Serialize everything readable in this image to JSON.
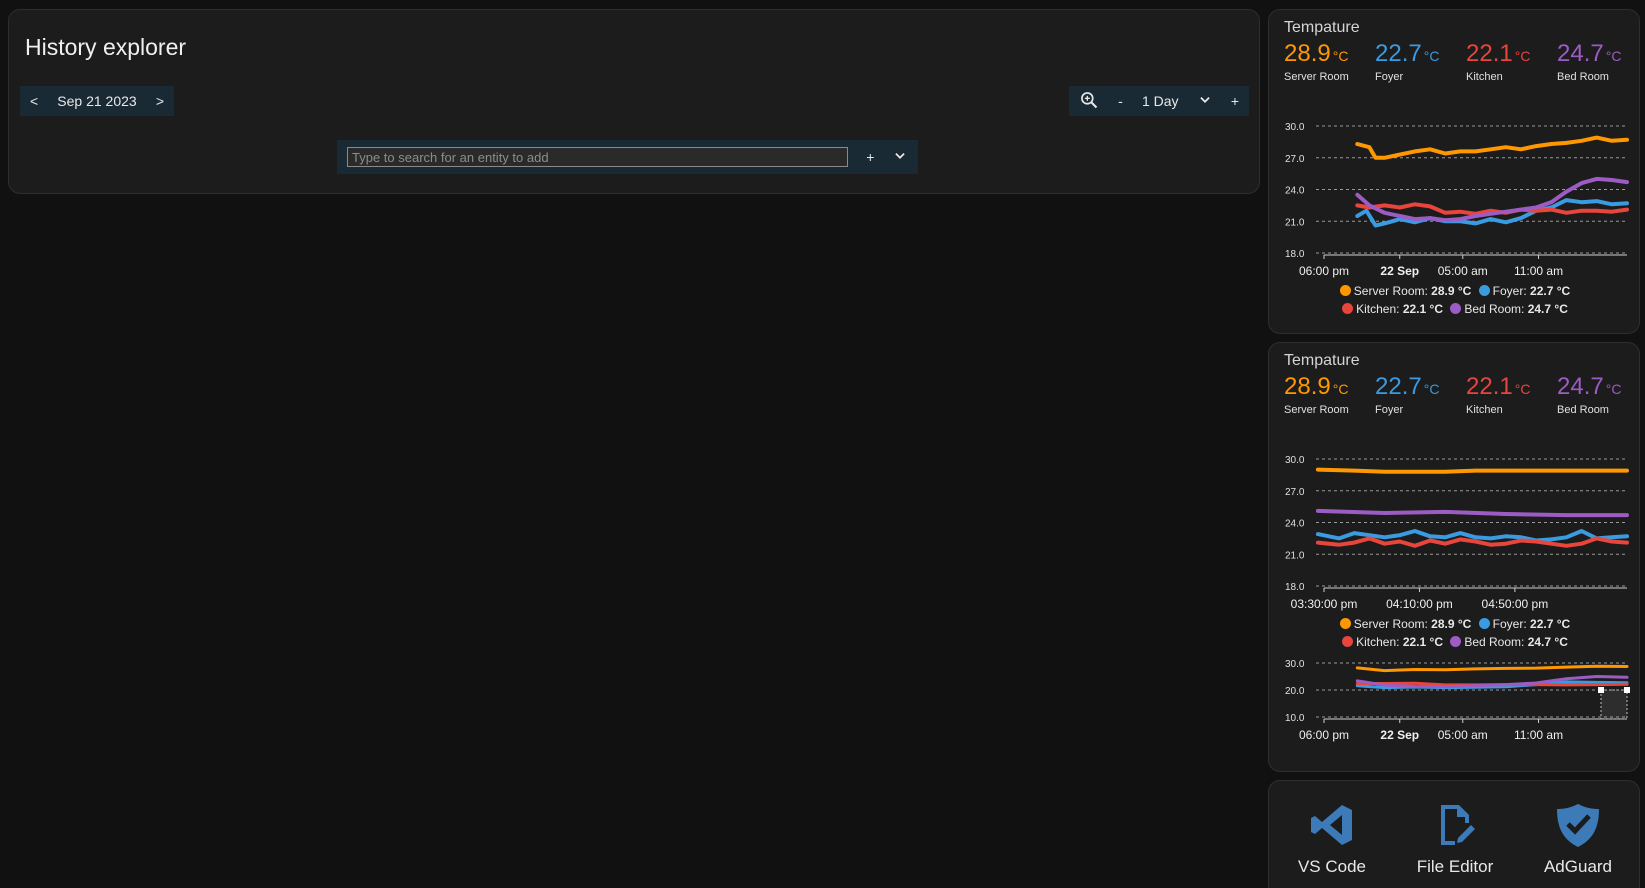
{
  "history": {
    "title": "History explorer",
    "date_prev": "<",
    "date_label": "Sep 21 2023",
    "date_next": ">",
    "zoom_minus": "-",
    "range_label": "1 Day",
    "zoom_plus": "+",
    "search_placeholder": "Type to search for an entity to add",
    "add_label": "+"
  },
  "colors": {
    "server_room": "#ff9800",
    "foyer": "#3b9be0",
    "kitchen": "#e8453c",
    "bed_room": "#9c5cc4",
    "accent": "#1a2a35"
  },
  "cards": [
    {
      "title": "Tempature",
      "readings": [
        {
          "value": "28.9",
          "unit": "°C",
          "name": "Server Room"
        },
        {
          "value": "22.7",
          "unit": "°C",
          "name": "Foyer"
        },
        {
          "value": "22.1",
          "unit": "°C",
          "name": "Kitchen"
        },
        {
          "value": "24.7",
          "unit": "°C",
          "name": "Bed Room"
        }
      ],
      "legend": [
        {
          "name": "Server Room:",
          "value": "28.9 °C"
        },
        {
          "name": "Foyer:",
          "value": "22.7 °C"
        },
        {
          "name": "Kitchen:",
          "value": "22.1 °C"
        },
        {
          "name": "Bed Room:",
          "value": "24.7 °C"
        }
      ]
    },
    {
      "title": "Tempature",
      "readings": [
        {
          "value": "28.9",
          "unit": "°C",
          "name": "Server Room"
        },
        {
          "value": "22.7",
          "unit": "°C",
          "name": "Foyer"
        },
        {
          "value": "22.1",
          "unit": "°C",
          "name": "Kitchen"
        },
        {
          "value": "24.7",
          "unit": "°C",
          "name": "Bed Room"
        }
      ],
      "legend": [
        {
          "name": "Server Room:",
          "value": "28.9 °C"
        },
        {
          "name": "Foyer:",
          "value": "22.7 °C"
        },
        {
          "name": "Kitchen:",
          "value": "22.1 °C"
        },
        {
          "name": "Bed Room:",
          "value": "24.7 °C"
        }
      ]
    }
  ],
  "chart_data": [
    {
      "type": "line",
      "title": "",
      "ylim": [
        18,
        30
      ],
      "yticks": [
        "30.0",
        "27.0",
        "24.0",
        "21.0",
        "18.0"
      ],
      "yticks_num": [
        30,
        27,
        24,
        21,
        18
      ],
      "xlim": [
        0,
        1
      ],
      "xticks": [
        {
          "label": "06:00 pm",
          "pos": 0.0,
          "bold": false
        },
        {
          "label": "22 Sep",
          "pos": 0.25,
          "bold": true
        },
        {
          "label": "05:00 am",
          "pos": 0.458,
          "bold": false
        },
        {
          "label": "11:00 am",
          "pos": 0.708,
          "bold": false
        }
      ],
      "grid": true,
      "series": [
        {
          "name": "Server Room",
          "x": [
            0.11,
            0.15,
            0.17,
            0.2,
            0.25,
            0.3,
            0.35,
            0.4,
            0.45,
            0.5,
            0.55,
            0.6,
            0.65,
            0.7,
            0.75,
            0.8,
            0.85,
            0.9,
            0.95,
            1.0
          ],
          "y": [
            28.3,
            28.0,
            27.0,
            27.0,
            27.3,
            27.6,
            27.8,
            27.4,
            27.6,
            27.6,
            27.8,
            28.0,
            27.8,
            28.1,
            28.3,
            28.4,
            28.6,
            28.9,
            28.6,
            28.7
          ]
        },
        {
          "name": "Foyer",
          "x": [
            0.11,
            0.14,
            0.17,
            0.2,
            0.25,
            0.3,
            0.35,
            0.4,
            0.45,
            0.5,
            0.55,
            0.6,
            0.65,
            0.7,
            0.75,
            0.8,
            0.85,
            0.9,
            0.95,
            1.0
          ],
          "y": [
            21.5,
            22.0,
            20.6,
            20.8,
            21.2,
            20.9,
            21.3,
            21.0,
            21.0,
            20.8,
            21.2,
            20.9,
            21.3,
            22.0,
            22.3,
            23.0,
            22.8,
            22.9,
            22.6,
            22.7
          ]
        },
        {
          "name": "Kitchen",
          "x": [
            0.11,
            0.15,
            0.2,
            0.25,
            0.3,
            0.35,
            0.4,
            0.45,
            0.5,
            0.55,
            0.6,
            0.65,
            0.7,
            0.75,
            0.8,
            0.85,
            0.9,
            0.95,
            1.0
          ],
          "y": [
            22.5,
            22.3,
            22.5,
            22.3,
            22.6,
            22.4,
            21.8,
            21.9,
            21.7,
            22.0,
            21.8,
            22.1,
            22.0,
            22.1,
            21.8,
            22.0,
            22.0,
            21.9,
            22.1
          ]
        },
        {
          "name": "Bed Room",
          "x": [
            0.11,
            0.15,
            0.2,
            0.25,
            0.3,
            0.35,
            0.4,
            0.45,
            0.5,
            0.55,
            0.6,
            0.65,
            0.7,
            0.75,
            0.8,
            0.85,
            0.9,
            0.95,
            1.0
          ],
          "y": [
            23.5,
            22.5,
            21.8,
            21.5,
            21.2,
            21.3,
            21.1,
            21.2,
            21.5,
            21.7,
            21.9,
            22.1,
            22.3,
            22.8,
            23.8,
            24.6,
            25.0,
            24.9,
            24.7
          ]
        }
      ]
    },
    {
      "type": "line",
      "title": "",
      "ylim": [
        18,
        30
      ],
      "yticks": [
        "30.0",
        "27.0",
        "24.0",
        "21.0",
        "18.0"
      ],
      "yticks_num": [
        30,
        27,
        24,
        21,
        18
      ],
      "xlim": [
        0,
        1
      ],
      "xticks": [
        {
          "label": "03:30:00 pm",
          "pos": 0.0,
          "bold": false
        },
        {
          "label": "04:10:00 pm",
          "pos": 0.315,
          "bold": false
        },
        {
          "label": "04:50:00 pm",
          "pos": 0.63,
          "bold": false
        }
      ],
      "grid": true,
      "series": [
        {
          "name": "Server Room",
          "x": [
            -0.02,
            0.1,
            0.2,
            0.3,
            0.4,
            0.5,
            0.6,
            0.7,
            0.8,
            0.9,
            1.0
          ],
          "y": [
            29.0,
            28.9,
            28.8,
            28.8,
            28.8,
            28.9,
            28.9,
            28.9,
            28.9,
            28.9,
            28.9
          ]
        },
        {
          "name": "Foyer",
          "x": [
            -0.02,
            0.05,
            0.1,
            0.15,
            0.2,
            0.25,
            0.3,
            0.35,
            0.4,
            0.45,
            0.5,
            0.55,
            0.6,
            0.65,
            0.7,
            0.75,
            0.8,
            0.85,
            0.9,
            0.95,
            1.0
          ],
          "y": [
            22.9,
            22.5,
            23.0,
            22.8,
            22.6,
            22.8,
            23.2,
            22.7,
            22.6,
            23.0,
            22.6,
            22.5,
            22.7,
            22.6,
            22.3,
            22.4,
            22.6,
            23.2,
            22.5,
            22.6,
            22.7
          ]
        },
        {
          "name": "Kitchen",
          "x": [
            -0.02,
            0.05,
            0.1,
            0.15,
            0.2,
            0.25,
            0.3,
            0.35,
            0.4,
            0.45,
            0.5,
            0.55,
            0.6,
            0.65,
            0.7,
            0.75,
            0.8,
            0.85,
            0.9,
            0.95,
            1.0
          ],
          "y": [
            22.1,
            21.9,
            22.1,
            22.5,
            22.0,
            22.2,
            21.8,
            22.3,
            22.0,
            22.4,
            22.2,
            21.9,
            22.0,
            22.3,
            22.2,
            22.0,
            21.8,
            22.0,
            22.5,
            22.2,
            22.1
          ]
        },
        {
          "name": "Bed Room",
          "x": [
            -0.02,
            0.2,
            0.4,
            0.6,
            0.8,
            1.0
          ],
          "y": [
            25.1,
            24.9,
            25.0,
            24.8,
            24.7,
            24.7
          ]
        }
      ]
    },
    {
      "type": "line",
      "title": "",
      "ylim": [
        10,
        30
      ],
      "yticks": [
        "30.0",
        "20.0",
        "10.0"
      ],
      "yticks_num": [
        30,
        20,
        10
      ],
      "xlim": [
        0,
        1
      ],
      "xticks": [
        {
          "label": "06:00 pm",
          "pos": 0.0,
          "bold": false
        },
        {
          "label": "22 Sep",
          "pos": 0.25,
          "bold": true
        },
        {
          "label": "05:00 am",
          "pos": 0.458,
          "bold": false
        },
        {
          "label": "11:00 am",
          "pos": 0.708,
          "bold": false
        }
      ],
      "grid": true,
      "series": [
        {
          "name": "Server Room",
          "x": [
            0.11,
            0.2,
            0.3,
            0.4,
            0.5,
            0.6,
            0.7,
            0.8,
            0.9,
            1.0
          ],
          "y": [
            28.2,
            27.2,
            27.6,
            27.5,
            27.8,
            28.0,
            28.1,
            28.5,
            28.8,
            28.7
          ]
        },
        {
          "name": "Foyer",
          "x": [
            0.11,
            0.2,
            0.3,
            0.4,
            0.5,
            0.6,
            0.7,
            0.8,
            0.9,
            1.0
          ],
          "y": [
            21.6,
            20.9,
            21.1,
            20.9,
            21.0,
            21.2,
            22.0,
            23.0,
            22.8,
            22.7
          ]
        },
        {
          "name": "Kitchen",
          "x": [
            0.11,
            0.2,
            0.3,
            0.4,
            0.5,
            0.6,
            0.7,
            0.8,
            0.9,
            1.0
          ],
          "y": [
            22.4,
            22.4,
            22.5,
            21.9,
            21.9,
            22.0,
            22.0,
            21.9,
            22.0,
            22.1
          ]
        },
        {
          "name": "Bed Room",
          "x": [
            0.11,
            0.2,
            0.3,
            0.4,
            0.5,
            0.6,
            0.7,
            0.8,
            0.9,
            1.0
          ],
          "y": [
            23.4,
            21.8,
            21.3,
            21.2,
            21.6,
            22.0,
            22.6,
            24.2,
            25.0,
            24.7
          ]
        }
      ]
    }
  ],
  "shortcuts": [
    {
      "label": "VS Code",
      "icon": "vscode-icon"
    },
    {
      "label": "File Editor",
      "icon": "file-edit-icon"
    },
    {
      "label": "AdGuard",
      "icon": "shield-check-icon"
    }
  ]
}
